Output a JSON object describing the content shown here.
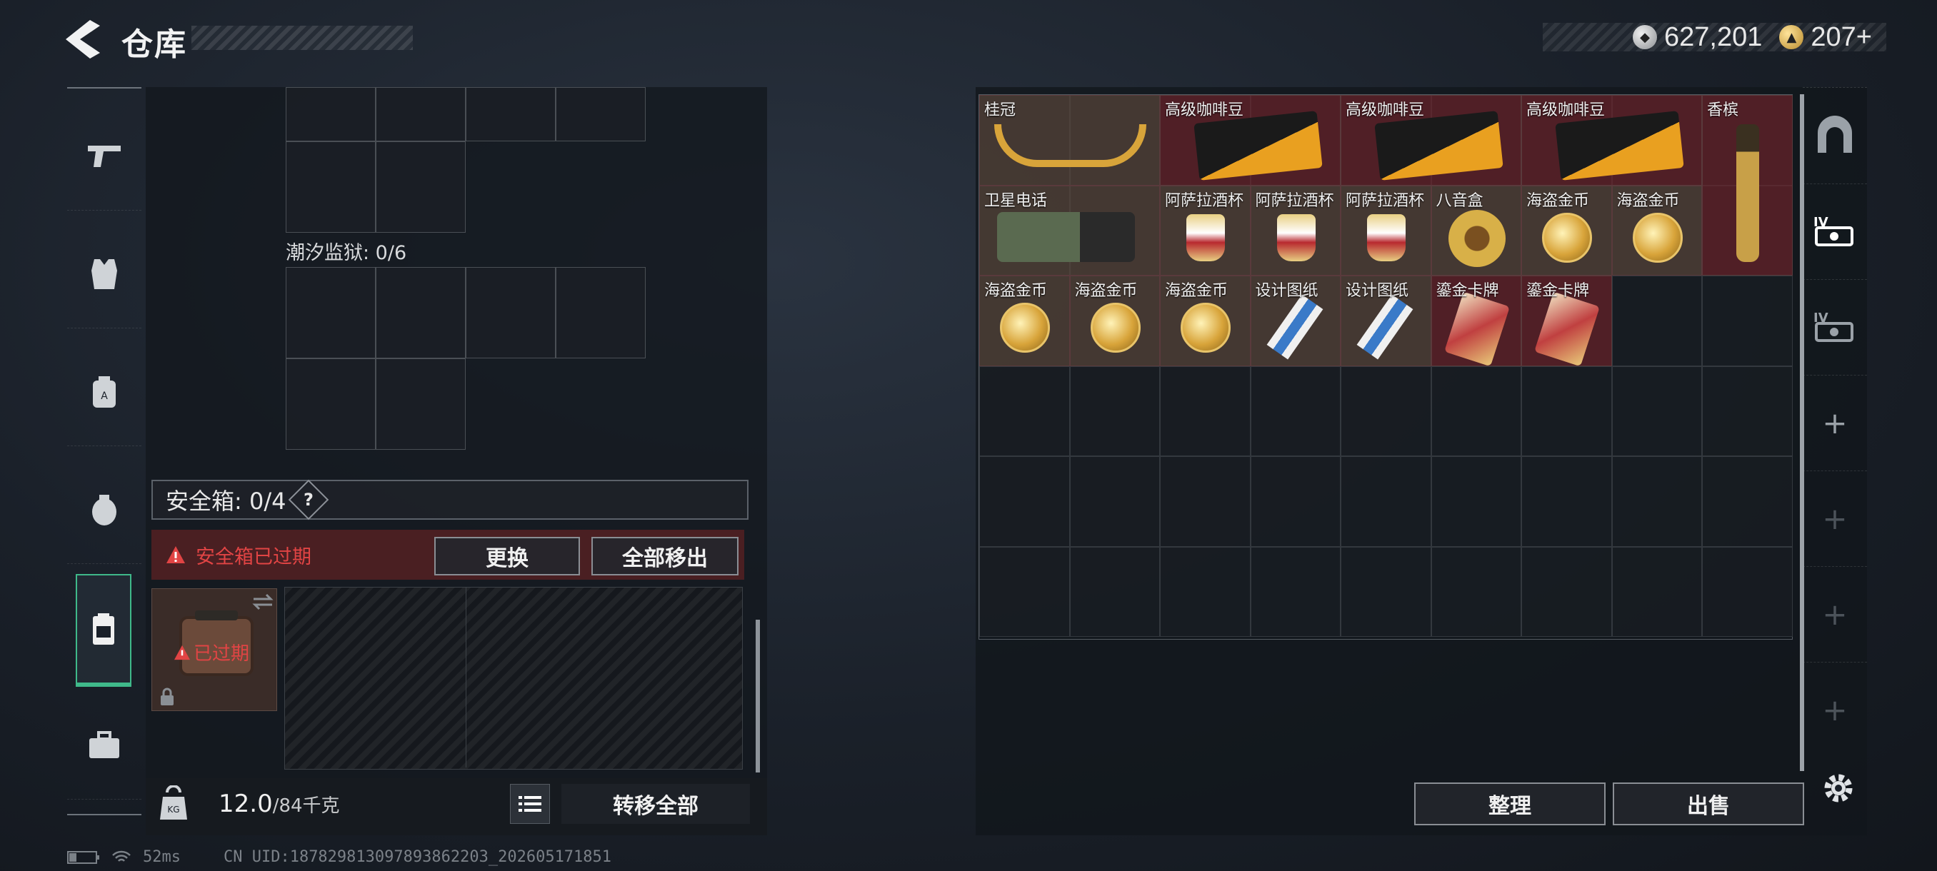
{
  "header": {
    "title": "仓库",
    "currency": [
      {
        "icon": "silver-coin-icon",
        "value": "627,201"
      },
      {
        "icon": "gold-coin-icon",
        "value": "207+"
      }
    ]
  },
  "sidebar": {
    "items": [
      {
        "icon": "gun-icon"
      },
      {
        "icon": "vest-icon"
      },
      {
        "icon": "backpack-icon"
      },
      {
        "icon": "helmet-bag-icon"
      },
      {
        "icon": "safe-box-icon",
        "active": true
      },
      {
        "icon": "toolbox-icon"
      }
    ]
  },
  "left": {
    "section_label": "潮汐监狱: 0/6",
    "safe_box_label": "安全箱: 0/4",
    "help": "?",
    "expired_warning": "安全箱已过期",
    "replace_button": "更换",
    "move_all_out_button": "全部移出",
    "case_expired_label": "已过期",
    "weight_current": "12.0",
    "weight_max": "/84千克",
    "transfer_all_button": "转移全部"
  },
  "stash": {
    "items": [
      {
        "name": "桂冠"
      },
      {
        "name": "高级咖啡豆"
      },
      {
        "name": "高级咖啡豆"
      },
      {
        "name": "高级咖啡豆"
      },
      {
        "name": "香槟"
      },
      {
        "name": "卫星电话"
      },
      {
        "name": "阿萨拉酒杯"
      },
      {
        "name": "阿萨拉酒杯"
      },
      {
        "name": "阿萨拉酒杯"
      },
      {
        "name": "八音盒"
      },
      {
        "name": "海盗金币"
      },
      {
        "name": "海盗金币"
      },
      {
        "name": "海盗金币"
      },
      {
        "name": "海盗金币"
      },
      {
        "name": "海盗金币"
      },
      {
        "name": "设计图纸"
      },
      {
        "name": "设计图纸"
      },
      {
        "name": "鎏金卡牌"
      },
      {
        "name": "鎏金卡牌"
      }
    ],
    "sort_button": "整理",
    "sell_button": "出售"
  },
  "footer": {
    "ping": "52ms",
    "uid": "CN UID:18782981309789386​2203_202605171851"
  }
}
